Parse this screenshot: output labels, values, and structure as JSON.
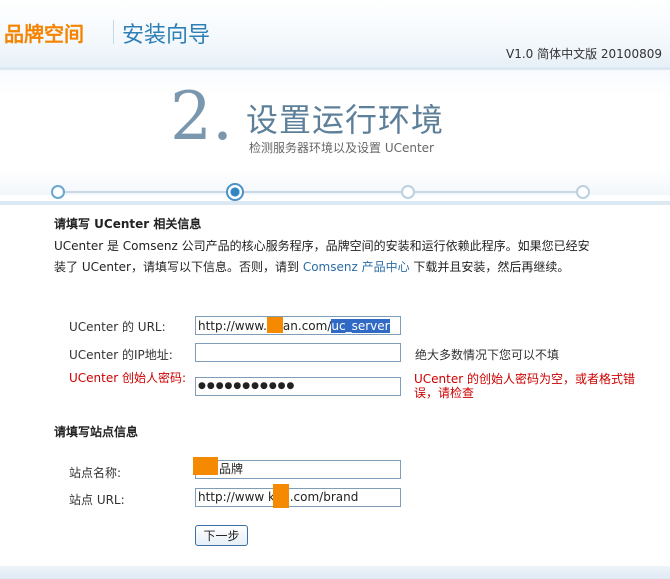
{
  "header": {
    "brand": "品牌空间",
    "wizard_title": "安装向导",
    "version": "V1.0 简体中文版 20100809"
  },
  "step": {
    "number": "2.",
    "title": "设置运行环境",
    "subtitle": "检测服务器环境以及设置 UCenter",
    "progress": {
      "total_steps": 4,
      "current_step": 2
    }
  },
  "ucenter": {
    "section_title": "请填写 UCenter 相关信息",
    "desc_before": "UCenter 是 Comsenz 公司产品的核心服务程序，品牌空间的安装和运行依赖此程序。如果您已经安装了 UCenter，请填写以下信息。否则，请到 ",
    "desc_link": "Comsenz 产品中心",
    "desc_after": " 下载并且安装，然后再继续。",
    "url_label": "UCenter 的 URL:",
    "url_value_prefix": "http://www.",
    "url_value_middle": "an.com/",
    "url_value_selected": "uc_server",
    "ip_label": "UCenter 的IP地址:",
    "ip_value": "",
    "ip_hint": "绝大多数情况下您可以不填",
    "password_label": "UCenter 创始人密码:",
    "password_value": "●●●●●●●●●●●",
    "password_error": "UCenter 的创始人密码为空，或者格式错误，请检查"
  },
  "site": {
    "section_title": "请填写站点信息",
    "name_label": "站点名称:",
    "name_value": "品牌",
    "url_label": "站点 URL:",
    "url_value": "http://www      kan.com/brand"
  },
  "buttons": {
    "next": "下一步"
  },
  "colors": {
    "brand": "#f58300",
    "link": "#2b6ea6",
    "error": "#cc0000",
    "title_blue": "#2f7fb7"
  }
}
